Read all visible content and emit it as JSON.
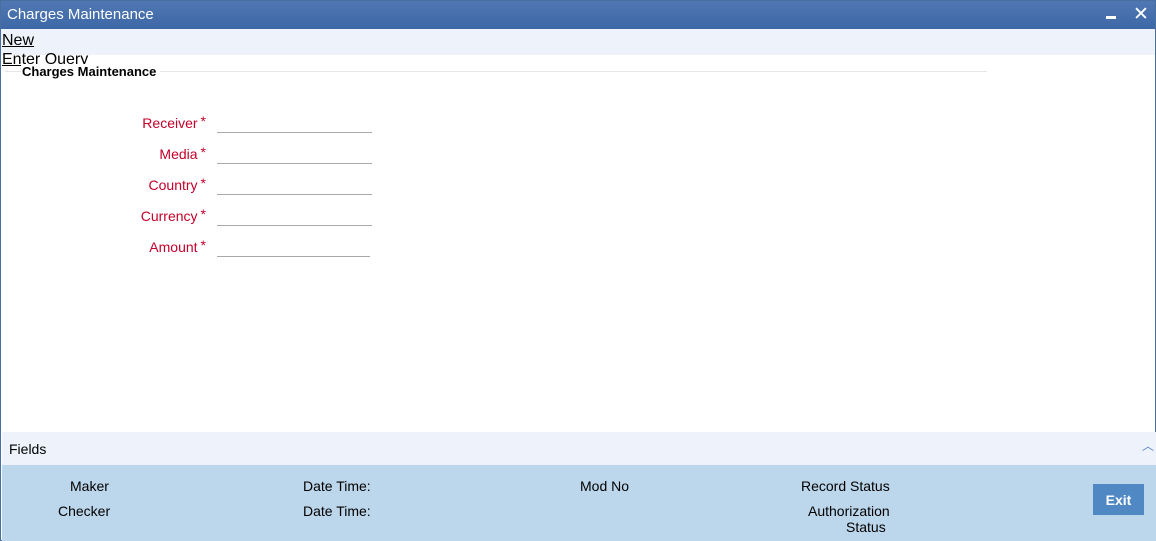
{
  "window": {
    "title": "Charges Maintenance",
    "minimize_icon": "minimize-icon",
    "close_icon": "close-icon"
  },
  "toolbar": {
    "new_label": "New",
    "enter_query_label": "Enter Query"
  },
  "section": {
    "title": "Charges Maintenance"
  },
  "form": {
    "required_marker": "*",
    "fields": [
      {
        "label": "Receiver",
        "value": ""
      },
      {
        "label": "Media",
        "value": ""
      },
      {
        "label": "Country",
        "value": ""
      },
      {
        "label": "Currency",
        "value": ""
      },
      {
        "label": "Amount",
        "value": ""
      }
    ]
  },
  "fields_bar": {
    "label": "Fields",
    "toggle_icon": "chevron-up-icon"
  },
  "audit": {
    "maker": "Maker",
    "maker_date_time": "Date Time:",
    "mod_no": "Mod No",
    "record_status": "Record Status",
    "checker": "Checker",
    "checker_date_time": "Date Time:",
    "authorization_status_line1": "Authorization",
    "authorization_status_line2": "Status",
    "exit_label": "Exit"
  },
  "colors": {
    "titlebar": "#3d67a6",
    "required_label": "#c4002a",
    "audit_background": "#bcd6eb",
    "exit_button": "#4f88c3"
  }
}
